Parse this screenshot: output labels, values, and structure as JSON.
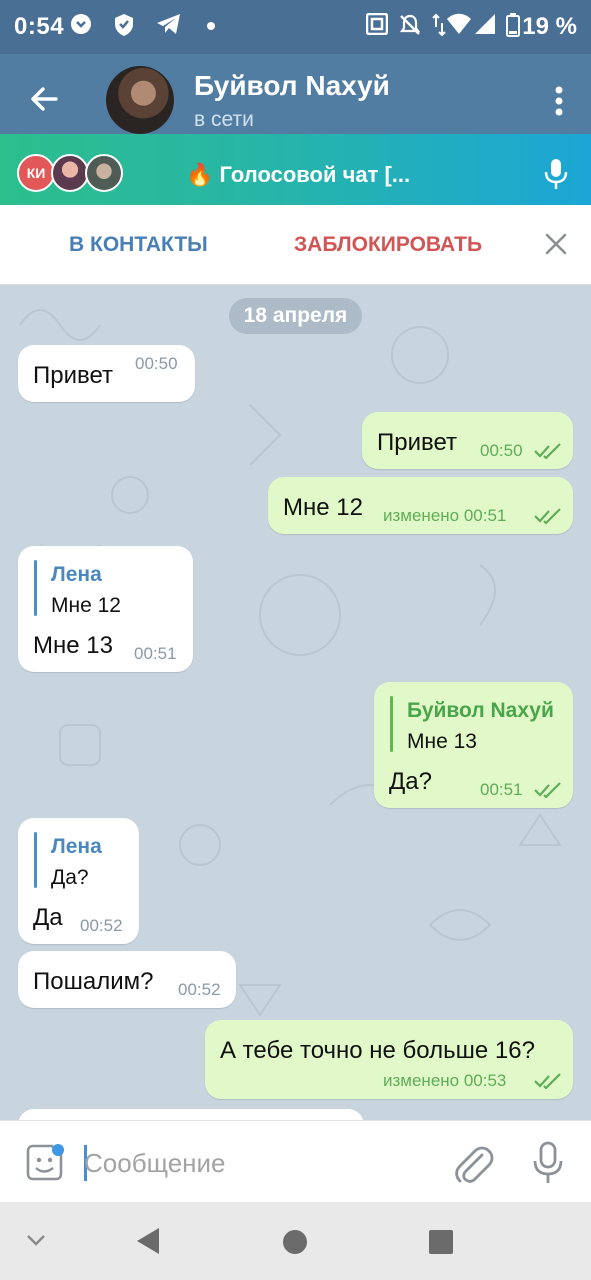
{
  "status_bar": {
    "time": "0:54",
    "battery": "19 %"
  },
  "header": {
    "title": "Буйвол Naхуй",
    "status": "в сети"
  },
  "voice_chat": {
    "avatar_initials": "КИ",
    "label": "🔥 Голосовой чат [..."
  },
  "actions": {
    "add_contact": "В КОНТАКТЫ",
    "block": "ЗАБЛОКИРОВАТЬ"
  },
  "date_separator": "18 апреля",
  "messages": [
    {
      "text": "Привет",
      "time": "00:50"
    },
    {
      "text": "Привет",
      "time": "00:50"
    },
    {
      "text": "Мне 12",
      "time": "изменено 00:51"
    },
    {
      "reply_name": "Лена",
      "reply_text": "Мне 12",
      "text": "Мне 13",
      "time": "00:51"
    },
    {
      "reply_name": "Буйвол Naхуй",
      "reply_text": "Мне 13",
      "text": "Да?",
      "time": "00:51"
    },
    {
      "reply_name": "Лена",
      "reply_text": "Да?",
      "text": "Да",
      "time": "00:52"
    },
    {
      "text": "Пошалим?",
      "time": "00:52"
    },
    {
      "text": "А тебе точно не больше 16?",
      "time": "изменено 00:53"
    }
  ],
  "composer": {
    "placeholder": "Сообщение",
    "value": ""
  },
  "colors": {
    "header": "#527da3",
    "status_bar": "#4a6f95",
    "chat_background": "#c9d5de",
    "outgoing_bubble": "#e1f8c9",
    "incoming_bubble": "#ffffff",
    "block_red": "#d25555",
    "link_blue": "#4a7fb5"
  }
}
